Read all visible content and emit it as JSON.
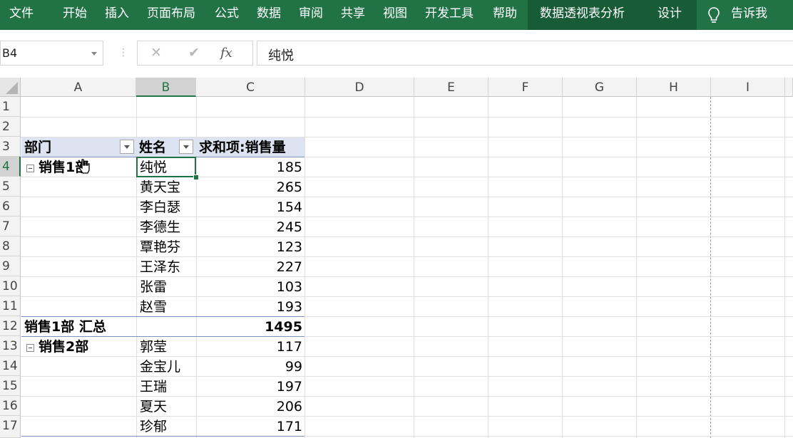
{
  "ribbon": {
    "tabs": [
      "文件",
      "开始",
      "插入",
      "页面布局",
      "公式",
      "数据",
      "审阅",
      "共享",
      "视图",
      "开发工具",
      "帮助"
    ],
    "context_tabs": [
      "数据透视表分析",
      "设计"
    ],
    "tell_me": "告诉我",
    "bg_color": "#217346",
    "context_bg_color": "#185c37"
  },
  "formula_bar": {
    "name_box": "B4",
    "cancel_icon": "✕",
    "enter_icon": "✔",
    "fx_label": "fx",
    "content": "纯悦"
  },
  "grid": {
    "columns": [
      "A",
      "B",
      "C",
      "D",
      "E",
      "F",
      "G",
      "H",
      "I"
    ],
    "rows": [
      "1",
      "2",
      "3",
      "4",
      "5",
      "6",
      "7",
      "8",
      "9",
      "10",
      "11",
      "12",
      "13",
      "14",
      "15",
      "16",
      "17"
    ],
    "selected_cell": "B4"
  },
  "pivot": {
    "headers": {
      "dept": "部门",
      "name": "姓名",
      "sum": "求和项:销售量"
    },
    "group1": {
      "label": "销售1部",
      "rows": [
        {
          "name": "纯悦",
          "value": "185"
        },
        {
          "name": "黄天宝",
          "value": "265"
        },
        {
          "name": "李白瑟",
          "value": "154"
        },
        {
          "name": "李德生",
          "value": "245"
        },
        {
          "name": "覃艳芬",
          "value": "123"
        },
        {
          "name": "王泽东",
          "value": "227"
        },
        {
          "name": "张雷",
          "value": "103"
        },
        {
          "name": "赵雪",
          "value": "193"
        }
      ],
      "total_label": "销售1部 汇总",
      "total_value": "1495"
    },
    "group2": {
      "label": "销售2部",
      "rows": [
        {
          "name": "郭莹",
          "value": "117"
        },
        {
          "name": "金宝儿",
          "value": "99"
        },
        {
          "name": "王瑞",
          "value": "197"
        },
        {
          "name": "夏天",
          "value": "206"
        },
        {
          "name": "珍郁",
          "value": "171"
        }
      ]
    },
    "header_bg": "#dde3f0"
  }
}
